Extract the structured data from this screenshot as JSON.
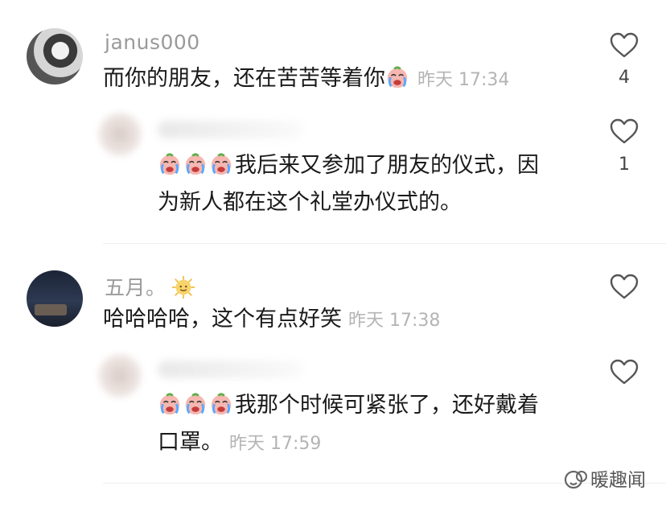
{
  "comments": [
    {
      "username": "janus000",
      "text": "而你的朋友，还在苦苦等着你",
      "time": "昨天 17:34",
      "likes": "4",
      "reply": {
        "emoji_prefix": [
          "crying-face",
          "crying-face",
          "crying-face"
        ],
        "line1": "我后来又参加了朋友的仪式，因",
        "line2": "为新人都在这个礼堂办仪式的。",
        "likes": "1"
      }
    },
    {
      "username": "五月。",
      "text": "哈哈哈哈，这个有点好笑",
      "time": "昨天 17:38",
      "reply": {
        "emoji_prefix": [
          "crying-face",
          "crying-face",
          "crying-face"
        ],
        "line1": "我那个时候可紧张了，还好戴着",
        "line2": "口罩。",
        "time": "昨天 17:59"
      }
    }
  ],
  "watermark": {
    "text": "暖趣闻",
    "icon": "wechat-official-account-icon"
  },
  "colors": {
    "username": "#9a9a9a",
    "time": "#b4b4b4",
    "heart_stroke": "#555555"
  }
}
